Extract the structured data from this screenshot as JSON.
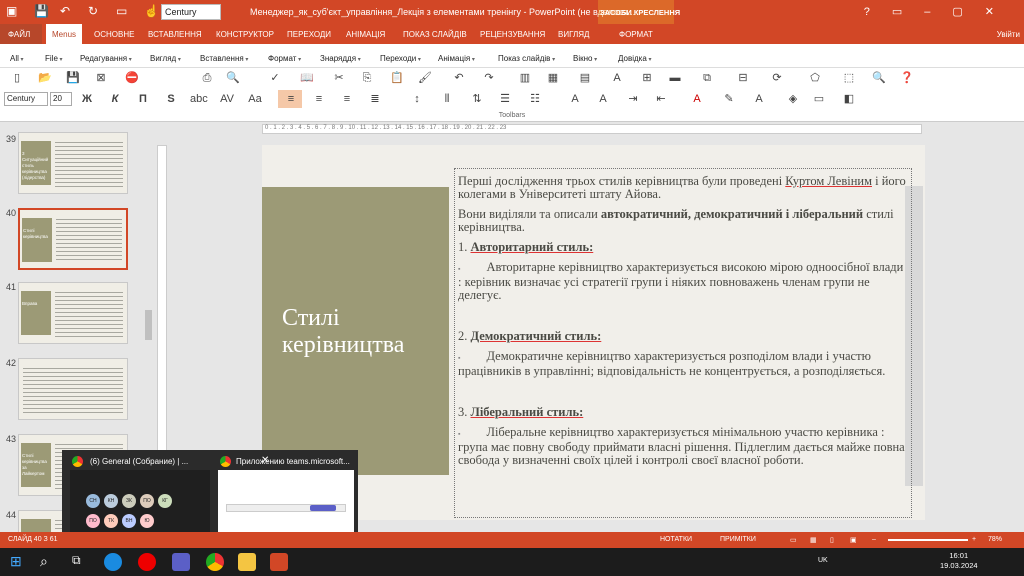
{
  "titlebar": {
    "font_box": "Century",
    "document_title": "Менеджер_як_суб'єкт_управління_Лекція з елементами тренінгу - PowerPoint (не вдалося...",
    "context_tab": "ЗАСОБИ КРЕСЛЕННЯ",
    "window_controls": [
      "?",
      "▭",
      "–",
      "▢",
      "✕"
    ]
  },
  "ribbon_tabs": [
    "ФАЙЛ",
    "Menus",
    "ОСНОВНЕ",
    "ВСТАВЛЕННЯ",
    "КОНСТРУКТОР",
    "ПЕРЕХОДИ",
    "АНІМАЦІЯ",
    "ПОКАЗ СЛАЙДІВ",
    "РЕЦЕНЗУВАННЯ",
    "ВИГЛЯД",
    "ФОРМАТ"
  ],
  "signin": "Увійти",
  "menu": [
    "All",
    "File",
    "Редагування",
    "Вигляд",
    "Вставлення",
    "Формат",
    "Знаряддя",
    "Переходи",
    "Анімація",
    "Показ слайдів",
    "Вікно",
    "Довідка"
  ],
  "format_toolbar": {
    "font": "Century",
    "size": "20",
    "bold": "Ж",
    "italic": "К",
    "underline": "П",
    "shadow": "S"
  },
  "toolbars_label": "Toolbars",
  "slides": [
    {
      "num": "39",
      "title": "3 Ситуаційний стиль керівництва (лідерства)"
    },
    {
      "num": "40",
      "title": "Стилі керівництва"
    },
    {
      "num": "41",
      "title": "Вправа"
    },
    {
      "num": "42",
      "title": ""
    },
    {
      "num": "43",
      "title": "Стилі керівництва за Лайкертом"
    },
    {
      "num": "44",
      "title": ""
    }
  ],
  "ruler_text": "0 . 1 . 2 . 3 . 4 . 5 . 6 . 7 . 8 . 9 . 10 . 11 . 12 . 13 . 14 . 15 . 16 . 17 . 18 . 19 . 20 . 21 . 22 . 23",
  "slide": {
    "title": "Стилі керівництва",
    "p1_a": "Перші дослідження трьох стилів керівництва були проведені ",
    "p1_name": "Куртом Левіним",
    "p1_b": " і його колегами в Університеті штату Айова.",
    "p2_a": "Вони виділяли та описали ",
    "p2_bold": "автократичний, демократичний і ліберальний",
    "p2_b": " стилі керівництва.",
    "h1_num": "1. ",
    "h1": "Авторитарний стиль:",
    "b1": "Авторитарне керівництво характеризується високою мірою одноосібної влади : керівник визначає усі стратегії групи і ніяких повноважень членам групи не делегує.",
    "h2_num": "2. ",
    "h2": "Демократичний стиль:",
    "b2": "Демократичне керівництво характеризується розподілом влади і участю працівників в управлінні; відповідальність не концентрується, а розподіляється.",
    "h3_num": "3. ",
    "h3": "Ліберальний стиль:",
    "b3": "Ліберальне керівництво характеризується мінімальною участю керівника : група має повну свободу приймати власні рішення. Підлеглим дається майже повна свобода у визначенні своїх цілей і контролі своєї власної роботи."
  },
  "taskbar_preview": {
    "item1": "(6) General (Собрание) | ...",
    "item2": "Приложению teams.microsoft...",
    "avatars": [
      "СН",
      "КН",
      "ЗК",
      "ПО",
      "КГ",
      "ПО",
      "ТК",
      "ВН",
      "Ю"
    ]
  },
  "status": {
    "slide": "СЛАЙД 40 З 61",
    "notes": "НОТАТКИ",
    "comments": "ПРИМІТКИ",
    "zoom": "78%"
  },
  "taskbar": {
    "lang": "UK",
    "time": "16:01",
    "date": "19.03.2024"
  },
  "colors": {
    "accent": "#d24726",
    "olive": "#9c9a76"
  }
}
